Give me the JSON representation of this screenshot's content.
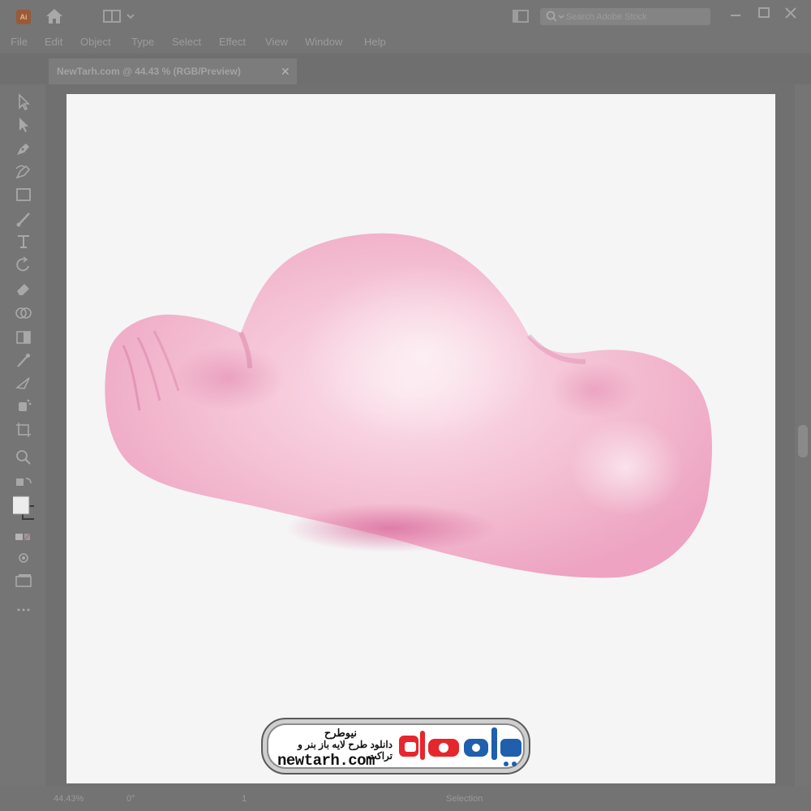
{
  "app": {
    "logo_text": "Ai",
    "search_placeholder": "Search Adobe Stock",
    "menu": [
      "File",
      "Edit",
      "Object",
      "Type",
      "Select",
      "Effect",
      "View",
      "Window",
      "Help"
    ]
  },
  "document": {
    "tab_label": "NewTarh.com @ 44.43 % (RGB/Preview)",
    "tab_close": "✕"
  },
  "tools": [
    "selection-tool-icon",
    "direct-selection-tool-icon",
    "pen-tool-icon",
    "curvature-tool-icon",
    "rectangle-tool-icon",
    "paintbrush-tool-icon",
    "type-tool-icon",
    "rotate-tool-icon",
    "eraser-tool-icon",
    "shape-builder-tool-icon",
    "gradient-tool-icon",
    "eyedropper-tool-icon",
    "blend-tool-icon",
    "symbol-sprayer-tool-icon",
    "artboard-tool-icon",
    "zoom-tool-icon",
    "swap-fill-stroke-icon",
    "fill-stroke-swatch-icon",
    "color-mode-icon",
    "draw-mode-icon",
    "screen-mode-icon",
    "more-tools-icon"
  ],
  "status": {
    "zoom": "44.43%",
    "rotation": "0°",
    "artboard_index": "1",
    "tool_name": "Selection"
  },
  "artwork": {
    "colors": {
      "cloud_base": "#eda3c1",
      "cloud_highlight": "#fbe0ea",
      "cloud_shadow": "#d86a9c",
      "artboard": "#f5f5f5"
    }
  },
  "watermark": {
    "title_fa": "نیوطرح",
    "subtitle_fa": "دانلود طرح لایه باز بنر و تراکت",
    "url": "newtarh.com",
    "logo_text": "نیوطرح",
    "colors": {
      "brand_red": "#e5272d",
      "brand_blue": "#1f5fae"
    }
  }
}
